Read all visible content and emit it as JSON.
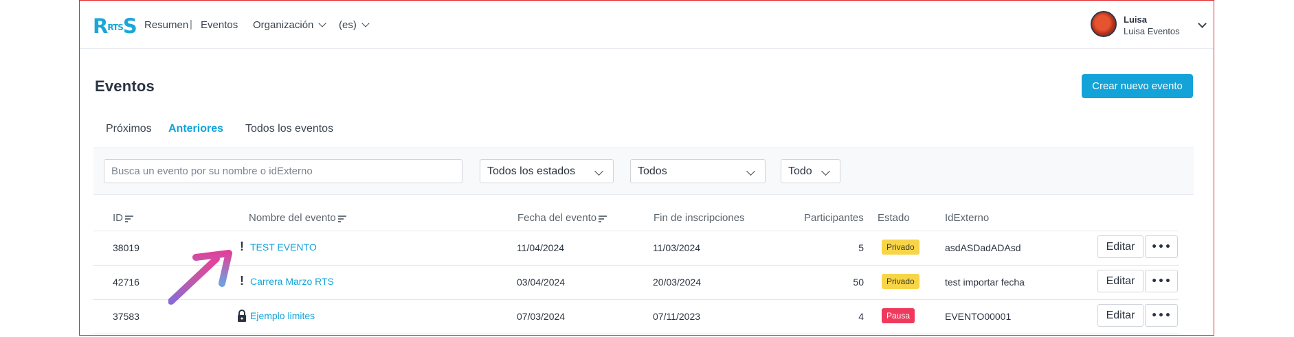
{
  "nav": {
    "logo": "R",
    "logo_small": "RTS",
    "logo_end": "S",
    "resumen": "Resumen",
    "sep": "|",
    "eventos": "Eventos",
    "organizacion": "Organización",
    "lang": "(es)"
  },
  "user": {
    "name": "Luisa",
    "org": "Luisa Eventos"
  },
  "page": {
    "title": "Eventos",
    "create_button": "Crear nuevo evento"
  },
  "tabs": [
    {
      "label": "Próximos",
      "active": false
    },
    {
      "label": "Anteriores",
      "active": true
    },
    {
      "label": "Todos los eventos",
      "active": false
    }
  ],
  "filters": {
    "search_placeholder": "Busca un evento por su nombre o idExterno",
    "estado": "Todos los estados",
    "tipo": "Todos",
    "fecha": "Todo"
  },
  "table": {
    "headers": {
      "id": "ID",
      "nombre": "Nombre del evento",
      "fecha": "Fecha del evento",
      "fin": "Fin de inscripciones",
      "participantes": "Participantes",
      "estado": "Estado",
      "idexterno": "IdExterno"
    },
    "rows": [
      {
        "id": "38019",
        "nombre": "TEST EVENTO",
        "fecha": "11/04/2024",
        "fin": "11/03/2024",
        "participantes": "5",
        "estado": "Privado",
        "idexterno": "asdASDadADAsd",
        "icon": "alert"
      },
      {
        "id": "42716",
        "nombre": "Carrera Marzo RTS",
        "fecha": "03/04/2024",
        "fin": "20/03/2024",
        "participantes": "50",
        "estado": "Privado",
        "idexterno": "test importar fecha",
        "icon": "alert"
      },
      {
        "id": "37583",
        "nombre": "Ejemplo limites",
        "fecha": "07/03/2024",
        "fin": "07/11/2023",
        "participantes": "4",
        "estado": "Pausa",
        "idexterno": "EVENTO00001",
        "icon": "lock"
      }
    ],
    "edit_label": "Editar",
    "more_label": "•••"
  },
  "colors": {
    "accent": "#13a3d8",
    "privado": "#f8d548",
    "pausa": "#ef3a5d",
    "frame": "#e0262b"
  }
}
